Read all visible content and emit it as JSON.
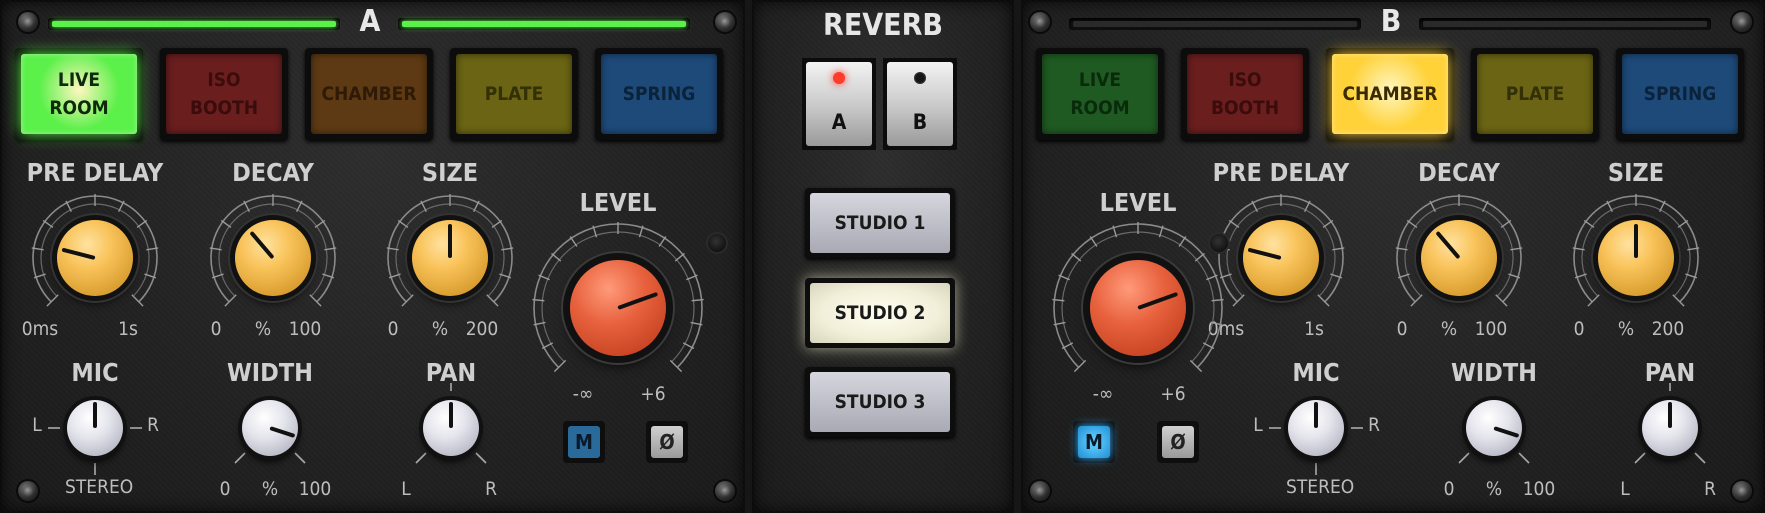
{
  "channel_a": {
    "letter": "A",
    "meter_color": "#5cf04a",
    "types": [
      {
        "line1": "LIVE",
        "line2": "ROOM",
        "state": "active",
        "color": "#5cf04a",
        "text": "#0d2a0a"
      },
      {
        "line1": "ISO",
        "line2": "BOOTH",
        "state": "off",
        "color": "#6a1e1e",
        "text": "#3a0c0c"
      },
      {
        "line1": "CHAMBER",
        "line2": "",
        "state": "off",
        "color": "#5e3a14",
        "text": "#2e1a06"
      },
      {
        "line1": "PLATE",
        "line2": "",
        "state": "off",
        "color": "#6a6414",
        "text": "#333006"
      },
      {
        "line1": "SPRING",
        "line2": "",
        "state": "off",
        "color": "#1e4a7a",
        "text": "#0a223a"
      }
    ],
    "pre_delay": {
      "label": "PRE DELAY",
      "min": "0ms",
      "max": "1s",
      "value": 0.22
    },
    "decay": {
      "label": "DECAY",
      "min": "0",
      "unit": "%",
      "max": "100",
      "value": 0.35
    },
    "size": {
      "label": "SIZE",
      "min": "0",
      "unit": "%",
      "max": "200",
      "value": 0.5
    },
    "level": {
      "label": "LEVEL",
      "min": "-∞",
      "max": "+6",
      "value": 0.76
    },
    "mic": {
      "label": "MIC",
      "left": "L",
      "right": "R",
      "bottom": "STEREO",
      "value": 0.5
    },
    "width": {
      "label": "WIDTH",
      "min": "0",
      "unit": "%",
      "max": "100",
      "value": 0.9
    },
    "pan": {
      "label": "PAN",
      "min": "L",
      "max": "R",
      "value": 0.5
    },
    "mono_label": "M",
    "phase_label": "Ø"
  },
  "center": {
    "title": "REVERB",
    "ab": [
      {
        "label": "A",
        "led": "#ff3b2b"
      },
      {
        "label": "B",
        "led": "#151515"
      }
    ],
    "studios": [
      {
        "label": "STUDIO 1",
        "active": false
      },
      {
        "label": "STUDIO 2",
        "active": true
      },
      {
        "label": "STUDIO 3",
        "active": false
      }
    ]
  },
  "channel_b": {
    "letter": "B",
    "meter_color": "#2a2a2a",
    "types": [
      {
        "line1": "LIVE",
        "line2": "ROOM",
        "state": "off",
        "color": "#1f5a22",
        "text": "#0a2a0c"
      },
      {
        "line1": "ISO",
        "line2": "BOOTH",
        "state": "off",
        "color": "#6a1e1e",
        "text": "#3a0c0c"
      },
      {
        "line1": "CHAMBER",
        "line2": "",
        "state": "active",
        "color": "#ffd23a",
        "text": "#3a2a00"
      },
      {
        "line1": "PLATE",
        "line2": "",
        "state": "off",
        "color": "#6a6414",
        "text": "#333006"
      },
      {
        "line1": "SPRING",
        "line2": "",
        "state": "off",
        "color": "#1e4a7a",
        "text": "#0a223a"
      }
    ],
    "pre_delay": {
      "label": "PRE DELAY",
      "min": "0ms",
      "max": "1s",
      "value": 0.22
    },
    "decay": {
      "label": "DECAY",
      "min": "0",
      "unit": "%",
      "max": "100",
      "value": 0.35
    },
    "size": {
      "label": "SIZE",
      "min": "0",
      "unit": "%",
      "max": "200",
      "value": 0.5
    },
    "level": {
      "label": "LEVEL",
      "min": "-∞",
      "max": "+6",
      "value": 0.76
    },
    "mic": {
      "label": "MIC",
      "left": "L",
      "right": "R",
      "bottom": "STEREO",
      "value": 0.5
    },
    "width": {
      "label": "WIDTH",
      "min": "0",
      "unit": "%",
      "max": "100",
      "value": 0.9
    },
    "pan": {
      "label": "PAN",
      "min": "L",
      "max": "R",
      "value": 0.5
    },
    "mono_label": "M",
    "phase_label": "Ø"
  }
}
